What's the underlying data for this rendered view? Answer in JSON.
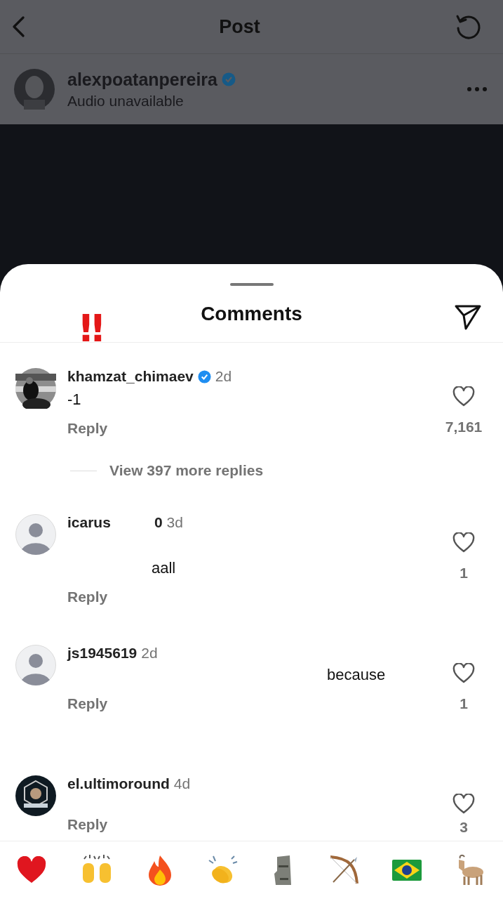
{
  "header": {
    "title": "Post"
  },
  "post": {
    "username": "alexpoatanpereira",
    "verified": true,
    "subtitle": "Audio unavailable"
  },
  "sheet": {
    "title": "Comments",
    "overlay_mark": "‼"
  },
  "comments": [
    {
      "username": "khamzat_chimaev",
      "verified": true,
      "time": "2d",
      "text": "-1",
      "reply": "Reply",
      "likes": "7,161",
      "more_replies": "View 397 more replies"
    },
    {
      "kind": "default",
      "username": "icarus",
      "username_extra": "0",
      "time": "3d",
      "text": "aall",
      "reply": "Reply",
      "likes": "1"
    },
    {
      "kind": "default",
      "username": "js1945619",
      "time": "2d",
      "text": "because",
      "reply": "Reply",
      "likes": "1"
    },
    {
      "kind": "logo",
      "username": "el.ultimoround",
      "time": "4d",
      "reply": "Reply",
      "likes": "3"
    }
  ],
  "reactions": [
    {
      "kind": "heart"
    },
    {
      "kind": "hands"
    },
    {
      "kind": "fire"
    },
    {
      "kind": "clap"
    },
    {
      "kind": "moai"
    },
    {
      "kind": "bow"
    },
    {
      "kind": "flag"
    },
    {
      "kind": "goat"
    }
  ]
}
